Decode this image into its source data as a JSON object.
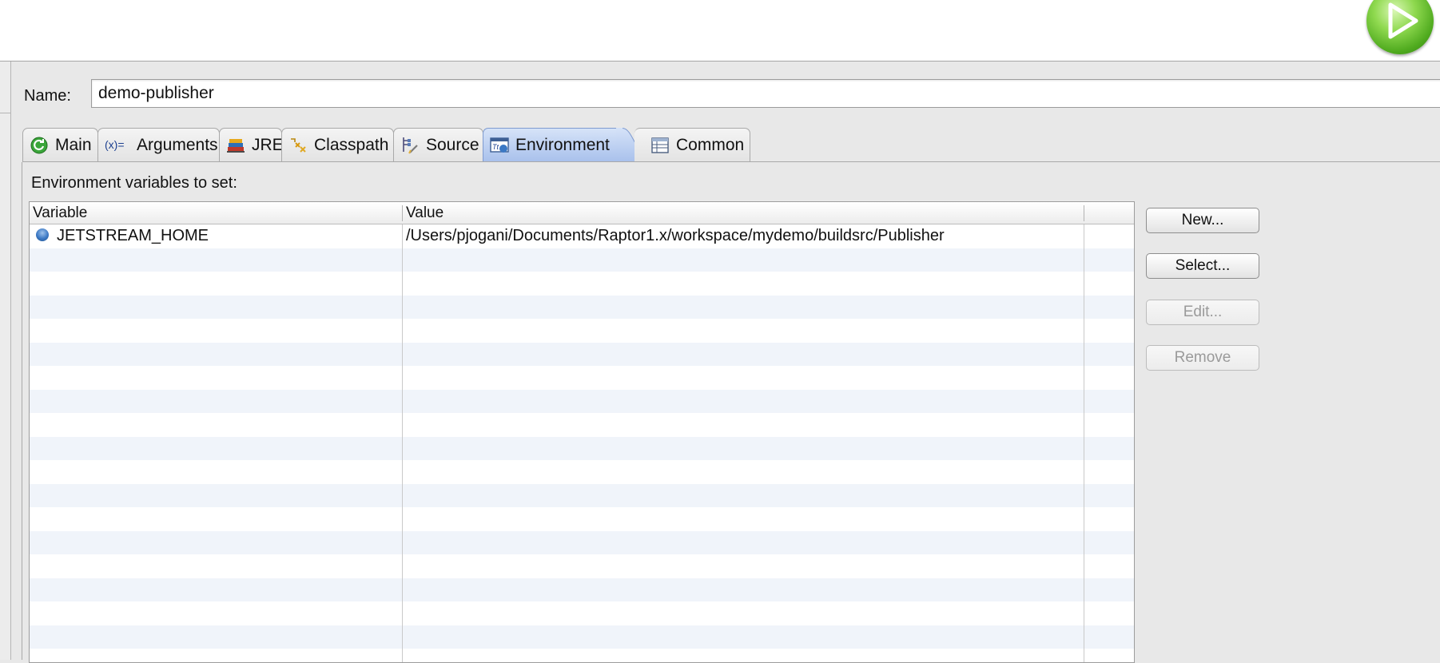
{
  "config": {
    "name_label": "Name:",
    "name_value": "demo-publisher"
  },
  "tabs": [
    {
      "label": "Main",
      "icon": "main-launch-icon"
    },
    {
      "label": "Arguments",
      "icon": "arguments-icon"
    },
    {
      "label": "JRE",
      "icon": "jre-library-icon"
    },
    {
      "label": "Classpath",
      "icon": "classpath-icon"
    },
    {
      "label": "Source",
      "icon": "source-lookup-icon"
    },
    {
      "label": "Environment",
      "icon": "environment-icon",
      "active": true
    },
    {
      "label": "Common",
      "icon": "common-table-icon"
    }
  ],
  "environment": {
    "heading": "Environment variables to set:",
    "columns": [
      "Variable",
      "Value"
    ],
    "rows": [
      {
        "variable": "JETSTREAM_HOME",
        "value": "/Users/pjogani/Documents/Raptor1.x/workspace/mydemo/buildsrc/Publisher"
      }
    ],
    "buttons": {
      "new": {
        "label": "New...",
        "enabled": true
      },
      "select": {
        "label": "Select...",
        "enabled": true
      },
      "edit": {
        "label": "Edit...",
        "enabled": false
      },
      "remove": {
        "label": "Remove",
        "enabled": false
      }
    }
  },
  "colors": {
    "active_tab": "#a9c1ec",
    "row_stripe": "#f0f4fa",
    "run_button": "#4faa1e"
  }
}
